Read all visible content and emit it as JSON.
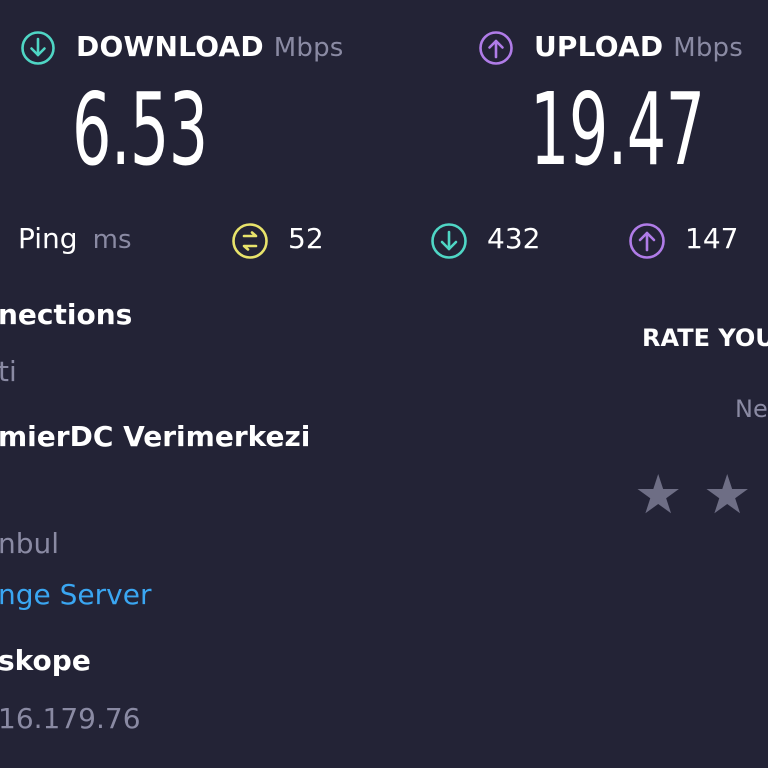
{
  "download": {
    "label": "DOWNLOAD",
    "unit": "Mbps",
    "value": "6.53",
    "icon": "download-arrow-icon",
    "color": "#4fd6c5"
  },
  "upload": {
    "label": "UPLOAD",
    "unit": "Mbps",
    "value": "19.47",
    "icon": "upload-arrow-icon",
    "color": "#b07ce8"
  },
  "ping": {
    "label": "Ping",
    "unit": "ms",
    "idle": "52",
    "download": "432",
    "upload": "147",
    "idle_color": "#e8e36b"
  },
  "connections": {
    "title": "nections",
    "sub": "ti"
  },
  "server": {
    "name": "mierDC Verimerkezi",
    "location": "nbul",
    "change_link": "nge Server"
  },
  "provider": {
    "name": "skope",
    "ip": "16.179.76"
  },
  "rate": {
    "title": "RATE YOU",
    "sub": "Ne",
    "stars_visible": 2
  }
}
